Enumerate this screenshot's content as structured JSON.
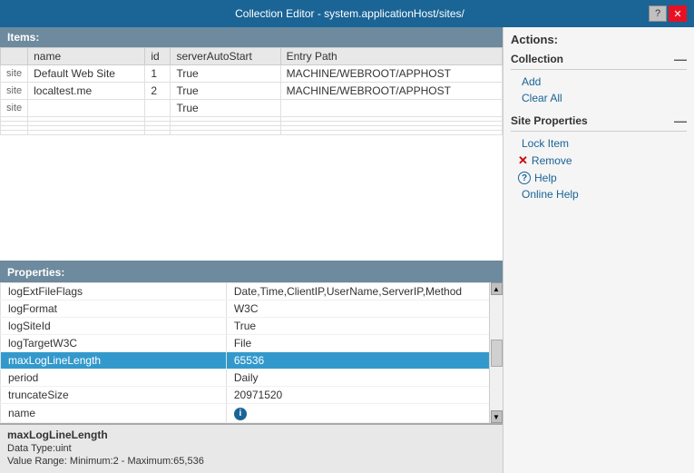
{
  "titleBar": {
    "title": "Collection Editor - system.applicationHost/sites/",
    "helpBtn": "?",
    "closeBtn": "✕"
  },
  "leftPanel": {
    "itemsSection": {
      "header": "Items:",
      "columns": [
        "name",
        "id",
        "serverAutoStart",
        "Entry Path"
      ],
      "rows": [
        {
          "label": "site",
          "name": "Default Web Site",
          "id": "1",
          "serverAutoStart": "True",
          "entryPath": "MACHINE/WEBROOT/APPHOST"
        },
        {
          "label": "site",
          "name": "localtest.me",
          "id": "2",
          "serverAutoStart": "True",
          "entryPath": "MACHINE/WEBROOT/APPHOST"
        },
        {
          "label": "site",
          "name": "",
          "id": "",
          "serverAutoStart": "True",
          "entryPath": ""
        }
      ]
    },
    "propertiesSection": {
      "header": "Properties:",
      "rows": [
        {
          "name": "logExtFileFlags",
          "value": "Date,Time,ClientIP,UserName,ServerIP,Method"
        },
        {
          "name": "logFormat",
          "value": "W3C"
        },
        {
          "name": "logSiteId",
          "value": "True"
        },
        {
          "name": "logTargetW3C",
          "value": "File"
        },
        {
          "name": "maxLogLineLength",
          "value": "65536",
          "selected": true
        },
        {
          "name": "period",
          "value": "Daily"
        },
        {
          "name": "truncateSize",
          "value": "20971520"
        },
        {
          "name": "name",
          "value": ""
        }
      ],
      "selectedProp": {
        "title": "maxLogLineLength",
        "dataType": "Data Type:uint",
        "valueRange": "Value Range: Minimum:2 - Maximum:65,536"
      }
    }
  },
  "rightPanel": {
    "header": "Actions:",
    "collection": {
      "title": "Collection",
      "add": "Add",
      "clearAll": "Clear All"
    },
    "siteProperties": {
      "title": "Site Properties",
      "lockItem": "Lock Item",
      "remove": "Remove",
      "help": "Help",
      "onlineHelp": "Online Help"
    }
  }
}
